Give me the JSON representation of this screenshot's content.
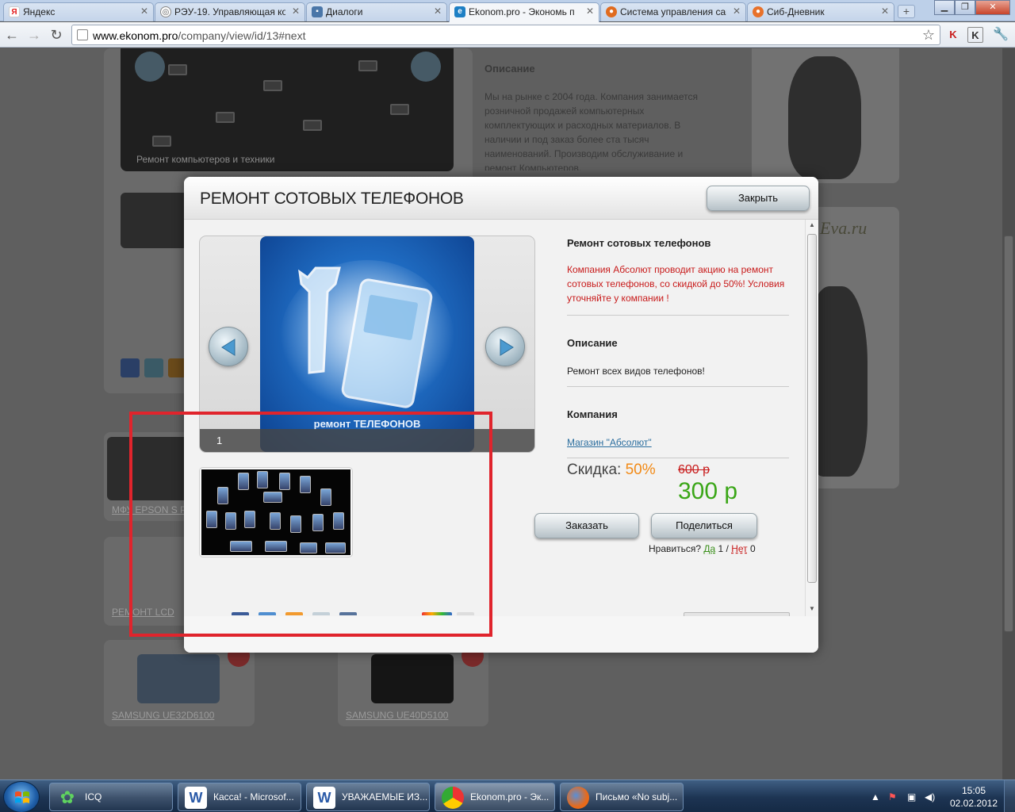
{
  "browser": {
    "tabs": [
      {
        "label": "Яндекс",
        "icon": "yandex-icon"
      },
      {
        "label": "РЭУ-19. Управляющая ко",
        "icon": "globe-icon"
      },
      {
        "label": "Диалоги",
        "icon": "chat-icon"
      },
      {
        "label": "Ekonom.pro - Экономь п",
        "icon": "ekonom-icon",
        "active": true
      },
      {
        "label": "Система управления сай",
        "icon": "cms-icon"
      },
      {
        "label": "Сиб-Дневник",
        "icon": "diary-icon"
      }
    ],
    "url_domain": "www.ekonom.pro",
    "url_path": "/company/view/id/13#next"
  },
  "background_page": {
    "description_title": "Описание",
    "description_text": "Мы на рынке с 2004 года. Компания занимается розничной продажей компьютерных комплектующих и расходных материалов. В наличии и под заказ более ста тысяч наименований. Производим обслуживание и ремонт Компьютеров,",
    "card1_label": "Ремонт компьютеров и техники",
    "card2_label": "МФУ EPSON S PH",
    "card3_label": "РЕМОНТ LCD",
    "card4_label": "SAMSUNG UE32D6100",
    "card5_label": "SAMSUNG UE40D5100",
    "ad_brand": "Eva.ru"
  },
  "modal": {
    "title": "РЕМОНТ СОТОВЫХ ТЕЛЕФОНОВ",
    "close_label": "Закрыть",
    "slide_caption": "ремонт ТЕЛЕФОНОВ",
    "slide_number": "1",
    "offer_title": "Ремонт сотовых телефонов",
    "promo_text": "Компания Абсолют проводит акцию на ремонт сотовых телефонов, со скидкой до 50%! Условия уточняйте у компании !",
    "description_title": "Описание",
    "description_text": "Ремонт всех видов телефонов!",
    "company_title": "Компания",
    "company_link": "Магазин \"Абсолют\"",
    "discount_label": "Скидка:",
    "discount_value": "50%",
    "old_price": "600 р",
    "new_price": "300 р",
    "order_label": "Заказать",
    "share_label": "Поделиться",
    "likes_question": "Нравиться?",
    "likes_yes": "Да",
    "likes_yes_count": "1",
    "likes_sep": "/",
    "likes_no": "Нет",
    "likes_no_count": "0"
  },
  "taskbar": {
    "tasks": [
      {
        "label": "ICQ",
        "icon": "icq-icon"
      },
      {
        "label": "Касса! - Microsof...",
        "icon": "word-icon"
      },
      {
        "label": "УВАЖАЕМЫЕ ИЗ...",
        "icon": "word-icon"
      },
      {
        "label": "Ekonom.pro - Эк...",
        "icon": "chrome-icon"
      },
      {
        "label": "Письмо «No subj...",
        "icon": "firefox-icon"
      }
    ],
    "time": "15:05",
    "date": "02.02.2012"
  },
  "colors": {
    "promo_red": "#c81b1b",
    "discount_orange": "#f28a16",
    "price_green": "#3aa617",
    "highlight_red": "#e0242c",
    "link_blue": "#2a6d9e"
  }
}
